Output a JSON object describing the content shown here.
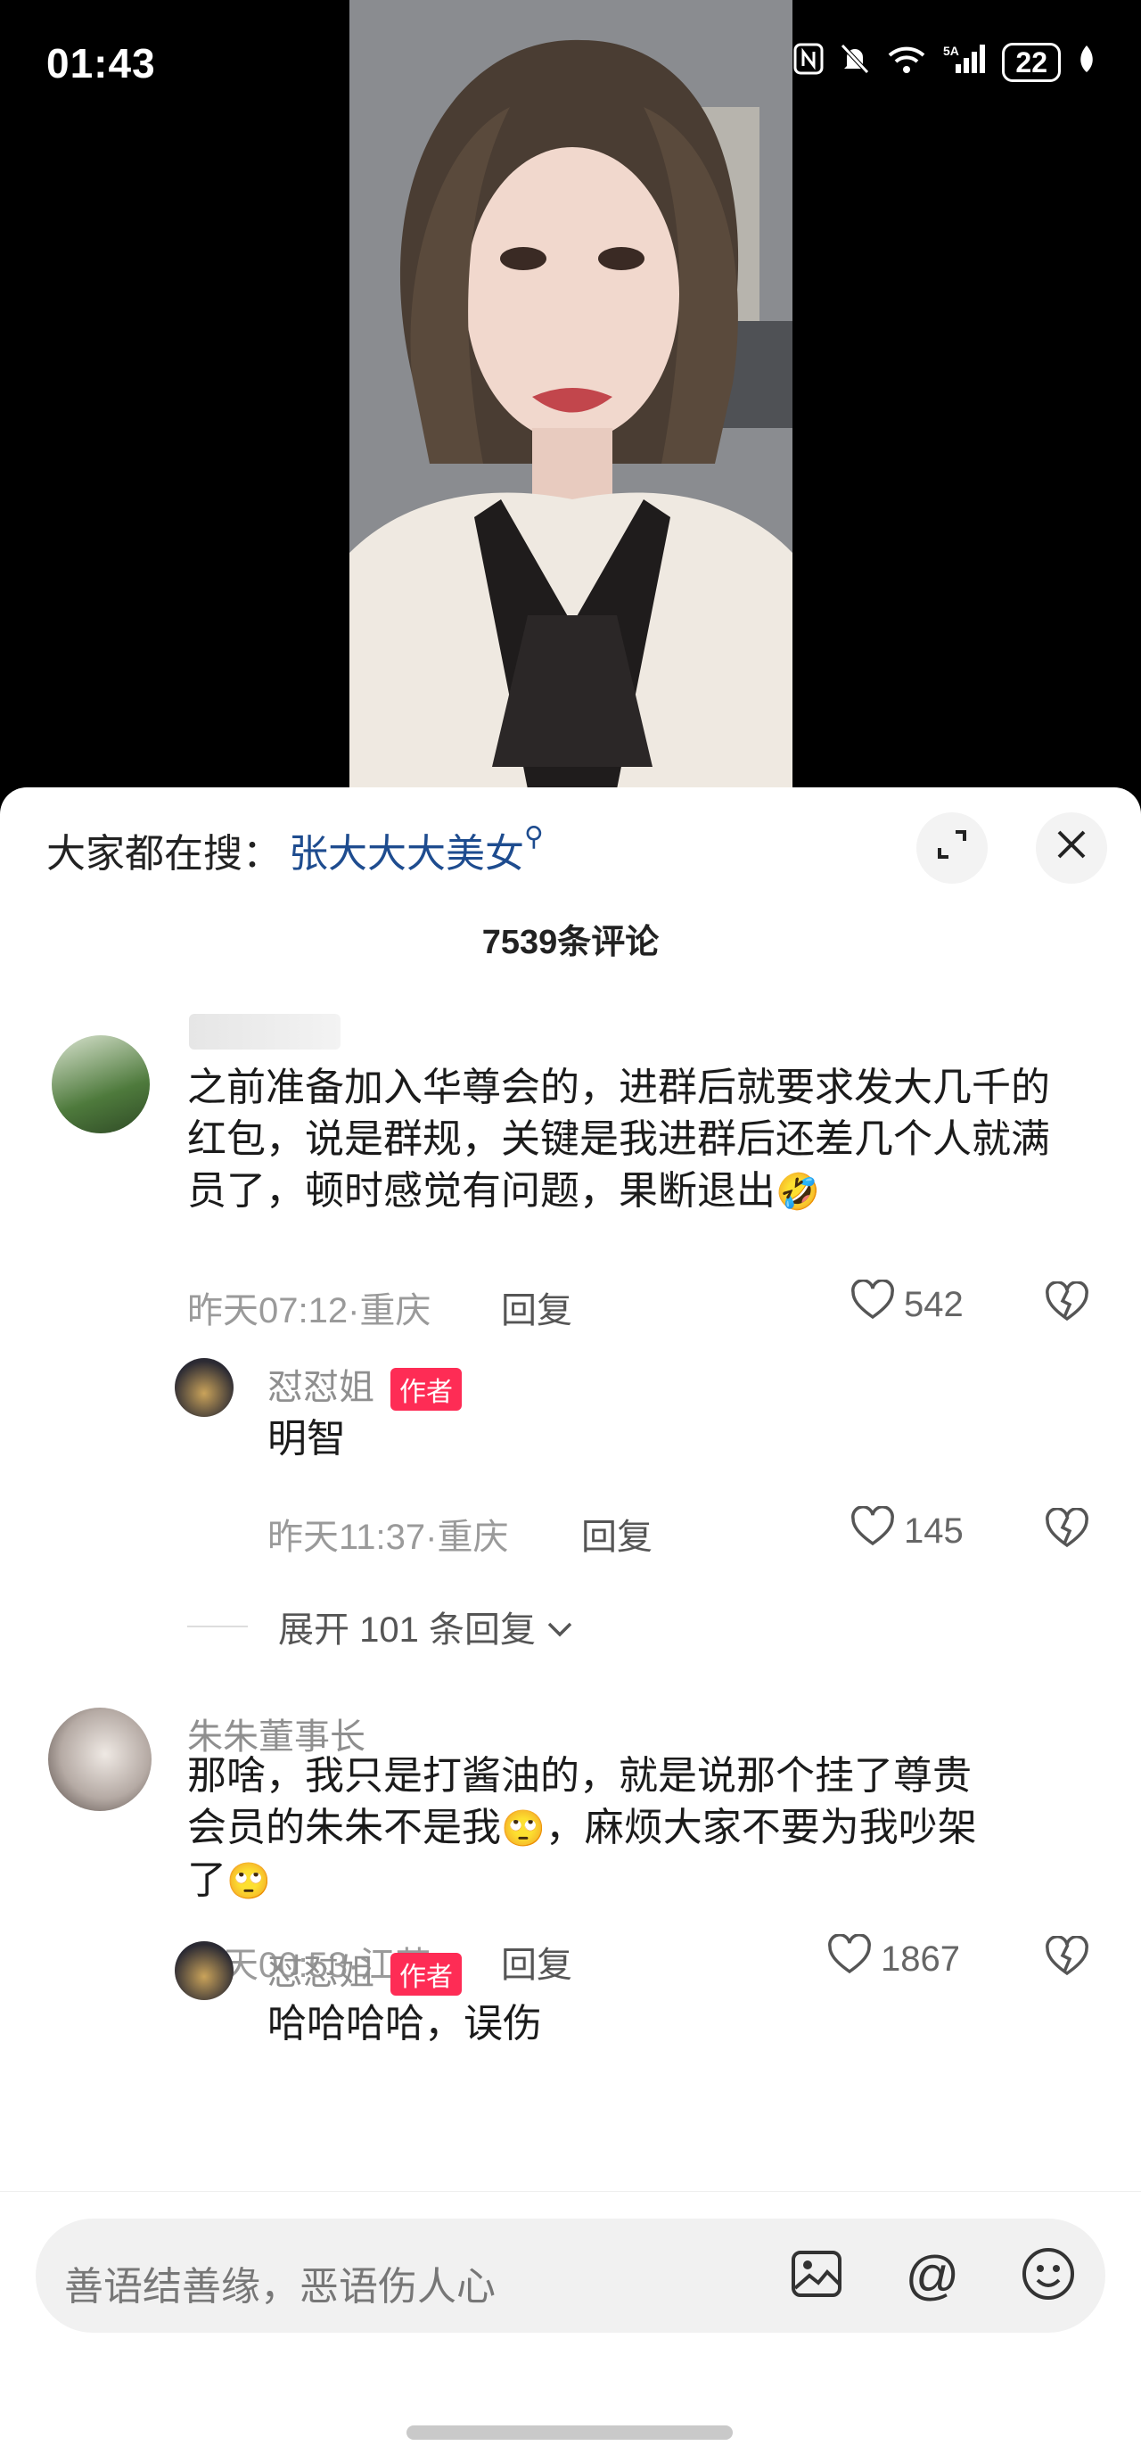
{
  "status_bar": {
    "time": "01:43",
    "signal": "5A",
    "wifi_tag": "6",
    "battery": "22"
  },
  "panel": {
    "search_prefix": "大家都在搜：",
    "search_term": "张大大大美女",
    "comment_count": "7539条评论"
  },
  "comments": [
    {
      "username": "",
      "text": "之前准备加入华尊会的，进群后就要求发大几千的红包，说是群规，关键是我进群后还差几个人就满员了，顿时感觉有问题，果断退出",
      "emoji": "🤣",
      "time_location": "昨天07:12·重庆",
      "reply": "回复",
      "likes": "542",
      "replies": [
        {
          "username": "怼怼姐",
          "badge": "作者",
          "text": "明智",
          "time_location": "昨天11:37·重庆",
          "reply": "回复",
          "likes": "145"
        }
      ],
      "expand": "展开 101 条回复"
    },
    {
      "username": "朱朱董事长",
      "text_line1": "那啥，我只是打酱油的，就是说那个挂了尊贵",
      "text_line2a": "会员的朱朱不是我",
      "text_line2b": "，麻烦大家不要为我吵架",
      "text_line3": "了",
      "emoji": "🙄",
      "time_location": "昨天00:53·江苏",
      "reply": "回复",
      "likes": "1867",
      "replies": [
        {
          "username": "怼怼姐",
          "badge": "作者",
          "text": "哈哈哈哈，误伤"
        }
      ]
    }
  ],
  "input": {
    "placeholder": "善语结善缘，恶语伤人心"
  },
  "icons": {
    "expand": "expand-icon",
    "close": "close-icon",
    "heart": "heart-icon",
    "broken_heart": "broken-heart-icon",
    "image": "image-icon",
    "at": "at-icon",
    "emoji": "emoji-icon"
  },
  "colors": {
    "accent": "#fe2c55",
    "link": "#1e4c8f"
  }
}
